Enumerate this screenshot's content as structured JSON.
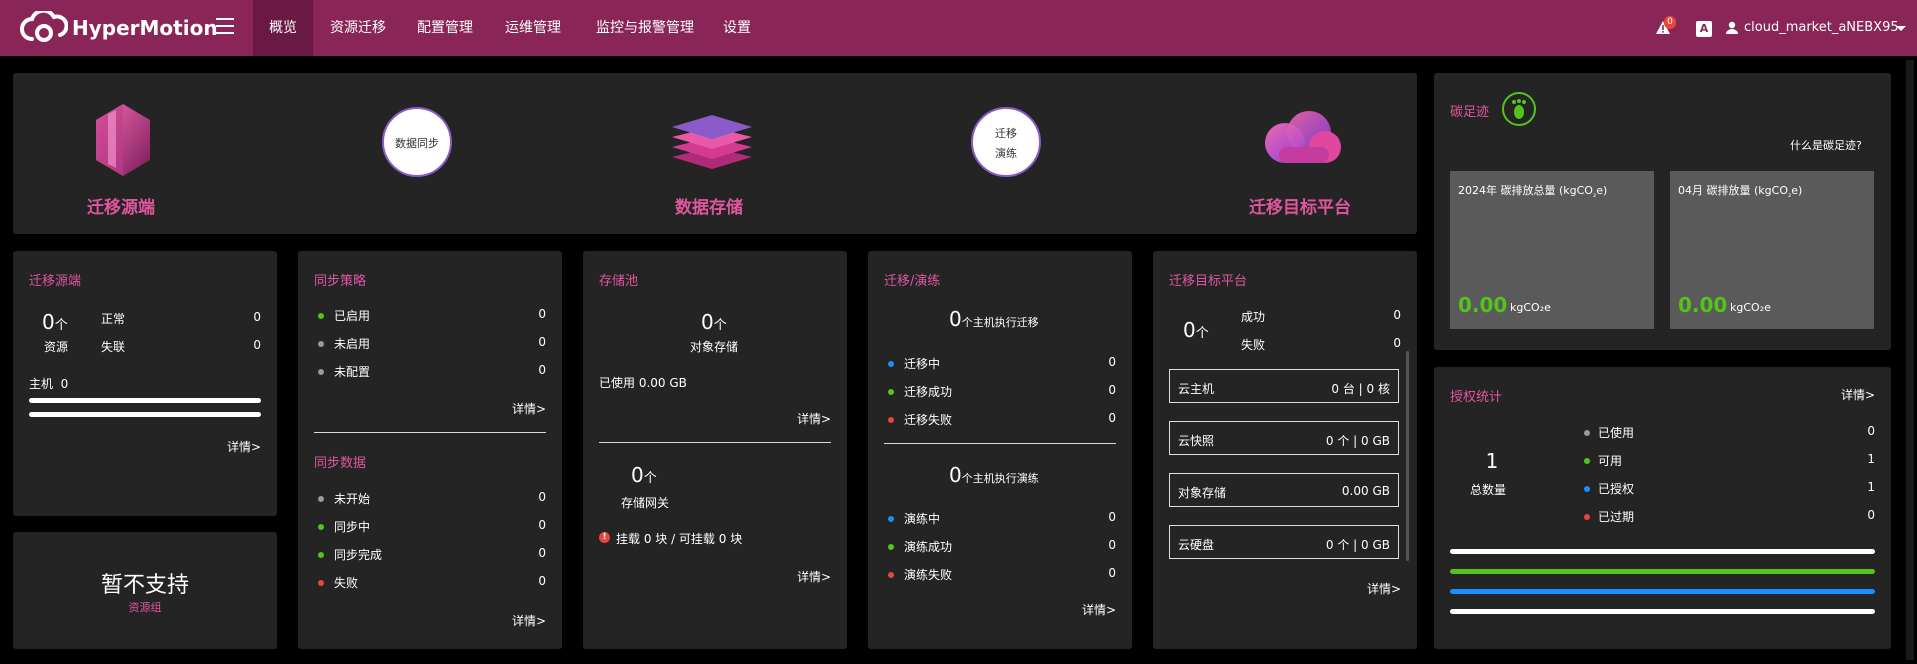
{
  "brand": {
    "logo_text": "HyperMotion",
    "color": "#8a2657"
  },
  "nav": {
    "items": [
      "概览",
      "资源迁移",
      "配置管理",
      "运维管理",
      "监控与报警管理",
      "设置"
    ],
    "active": 0
  },
  "header": {
    "alert_count": "0",
    "lang_icon": "A",
    "username": "cloud_market_aNEBX95"
  },
  "flow": {
    "source": "迁移源端",
    "sync": "数据同步",
    "storage": "数据存储",
    "drill_top": "迁移",
    "drill_bottom": "演练",
    "target": "迁移目标平台"
  },
  "carbon": {
    "title": "碳足迹",
    "link": "什么是碳足迹?",
    "year_label_pre": "2024年 碳排放总量 (kgCO",
    "year_label_post": "e)",
    "month_label_pre": "04月 碳排放量 (kgCO",
    "month_label_post": "e)",
    "sub2": "₂",
    "year_value": "0.00",
    "month_value": "0.00",
    "unit": "kgCO₂e"
  },
  "source_panel": {
    "title": "迁移源端",
    "count": "0",
    "count_unit": "个",
    "count_label": "资源",
    "normal_label": "正常",
    "normal_value": "0",
    "lost_label": "失联",
    "lost_value": "0",
    "host_label": "主机",
    "host_value": "0",
    "detail": "详情>"
  },
  "resource_group": {
    "text": "暂不支持",
    "sub": "资源组"
  },
  "sync_policy": {
    "title": "同步策略",
    "items": [
      {
        "label": "已启用",
        "value": "0",
        "color": "#52c41a"
      },
      {
        "label": "未启用",
        "value": "0",
        "color": "#999999"
      },
      {
        "label": "未配置",
        "value": "0",
        "color": "#999999"
      }
    ],
    "detail": "详情>"
  },
  "sync_data": {
    "title": "同步数据",
    "items": [
      {
        "label": "未开始",
        "value": "0",
        "color": "#999999"
      },
      {
        "label": "同步中",
        "value": "0",
        "color": "#52c41a"
      },
      {
        "label": "同步完成",
        "value": "0",
        "color": "#52c41a"
      },
      {
        "label": "失败",
        "value": "0",
        "color": "#e8453c"
      }
    ],
    "detail": "详情>"
  },
  "storage_pool": {
    "title": "存储池",
    "obj_count": "0",
    "obj_unit": "个",
    "obj_label": "对象存储",
    "used": "已使用 0.00 GB",
    "detail1": "详情>",
    "gw_count": "0",
    "gw_unit": "个",
    "gw_label": "存储网关",
    "mount": "挂载 0 块 / 可挂载 0 块",
    "detail2": "详情>"
  },
  "migrate_drill": {
    "title": "迁移/演练",
    "mig_count": "0",
    "mig_label": "个主机执行迁移",
    "mig_items": [
      {
        "label": "迁移中",
        "value": "0",
        "color": "#1890ff"
      },
      {
        "label": "迁移成功",
        "value": "0",
        "color": "#52c41a"
      },
      {
        "label": "迁移失败",
        "value": "0",
        "color": "#e8453c"
      }
    ],
    "drill_count": "0",
    "drill_label": "个主机执行演练",
    "drill_items": [
      {
        "label": "演练中",
        "value": "0",
        "color": "#1890ff"
      },
      {
        "label": "演练成功",
        "value": "0",
        "color": "#52c41a"
      },
      {
        "label": "演练失败",
        "value": "0",
        "color": "#e8453c"
      }
    ],
    "detail": "详情>"
  },
  "target_panel": {
    "title": "迁移目标平台",
    "count": "0",
    "count_unit": "个",
    "success_label": "成功",
    "success_value": "0",
    "fail_label": "失败",
    "fail_value": "0",
    "boxes": [
      {
        "label": "云主机",
        "value": "0 台  |  0 核"
      },
      {
        "label": "云快照",
        "value": "0 个  |  0 GB"
      },
      {
        "label": "对象存储",
        "value": "0.00 GB"
      },
      {
        "label": "云硬盘",
        "value": "0 个  |  0 GB"
      }
    ],
    "detail": "详情>"
  },
  "license": {
    "title": "授权统计",
    "detail": "详情>",
    "total": "1",
    "total_label": "总数量",
    "items": [
      {
        "label": "已使用",
        "value": "0",
        "color": "#999999"
      },
      {
        "label": "可用",
        "value": "1",
        "color": "#52c41a"
      },
      {
        "label": "已授权",
        "value": "1",
        "color": "#1890ff"
      },
      {
        "label": "已过期",
        "value": "0",
        "color": "#e8453c"
      }
    ],
    "bar_colors": [
      "#ffffff",
      "#52c41a",
      "#1890ff",
      "#ffffff"
    ]
  }
}
